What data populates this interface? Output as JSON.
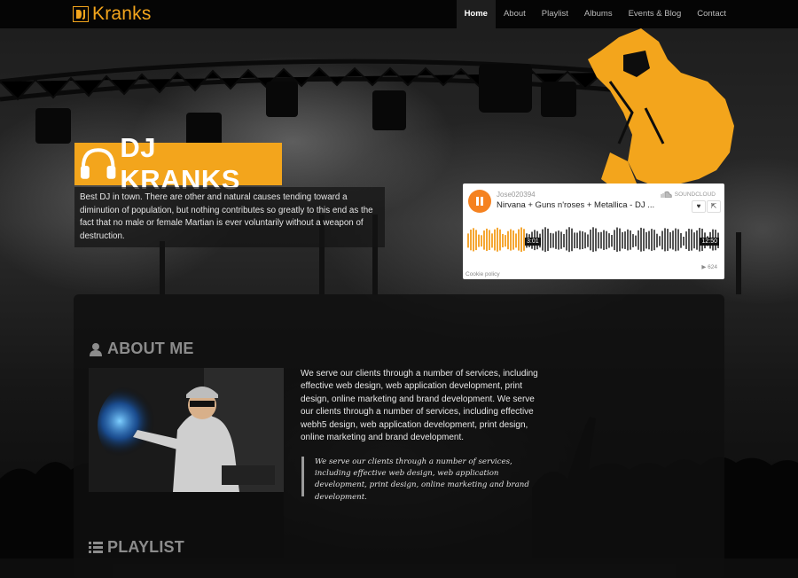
{
  "header": {
    "logo_text": "Kranks",
    "nav": [
      {
        "label": "Home",
        "active": true
      },
      {
        "label": "About"
      },
      {
        "label": "Playlist"
      },
      {
        "label": "Albums"
      },
      {
        "label": "Events & Blog"
      },
      {
        "label": "Contact"
      }
    ]
  },
  "hero": {
    "title": "DJ KRANKS",
    "description": "Best DJ in town. There are other and natural causes tending toward a diminution of population, but nothing contributes so greatly to this end as the fact that no male or female Martian is ever voluntarily without a weapon of destruction."
  },
  "player": {
    "user": "Jose020394",
    "track": "Nirvana + Guns n'roses + Metallica - DJ ...",
    "brand": "SOUNDCLOUD",
    "current_time": "3:01",
    "duration": "12:50",
    "progress_fraction": 0.23,
    "cookie_policy": "Cookie policy",
    "plays": "624",
    "accent": "#f58220"
  },
  "about": {
    "title": "ABOUT ME",
    "body": "We serve our clients through a number of services, including effective web design, web application development, print design, online marketing and brand development. We serve our clients through a number of services, including effective webh5 design, web application development, print design, online marketing and brand development.",
    "quote": "We serve our clients through a number of services, including effective web design, web application development, print design, online marketing and brand development."
  },
  "playlist": {
    "title": "PLAYLIST"
  },
  "colors": {
    "brand": "#f3a51c",
    "nav_bg": "#050505"
  },
  "icons": {
    "logo": "dj-monogram-icon",
    "hero": "headphones-icon",
    "about": "user-icon",
    "playlist": "list-icon",
    "like": "heart-icon",
    "share": "share-icon",
    "soundcloud": "soundcloud-cloud-icon",
    "play": "play-count-icon"
  }
}
